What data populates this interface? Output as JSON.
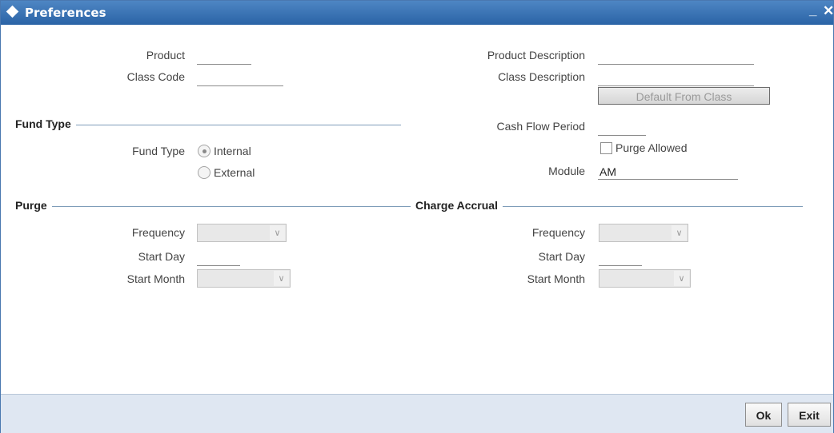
{
  "window": {
    "title": "Preferences",
    "minimize_glyph": "_",
    "close_glyph": "✕"
  },
  "product": {
    "label": "Product",
    "value": "",
    "desc_label": "Product Description",
    "desc_value": ""
  },
  "class_code": {
    "label": "Class Code",
    "value": "",
    "desc_label": "Class Description",
    "desc_value": ""
  },
  "default_button": "Default From Class",
  "fund_type": {
    "section": "Fund Type",
    "label": "Fund Type",
    "options": [
      "Internal",
      "External"
    ],
    "selected": "Internal"
  },
  "cash_flow": {
    "label": "Cash Flow Period",
    "value": ""
  },
  "purge_allowed": {
    "label": "Purge Allowed",
    "checked": false
  },
  "module": {
    "label": "Module",
    "value": "AM"
  },
  "purge": {
    "section": "Purge",
    "frequency_label": "Frequency",
    "frequency_value": "",
    "start_day_label": "Start Day",
    "start_day_value": "",
    "start_month_label": "Start Month",
    "start_month_value": ""
  },
  "charge_accrual": {
    "section": "Charge Accrual",
    "frequency_label": "Frequency",
    "frequency_value": "",
    "start_day_label": "Start Day",
    "start_day_value": "",
    "start_month_label": "Start Month",
    "start_month_value": ""
  },
  "footer": {
    "ok": "Ok",
    "exit": "Exit"
  }
}
